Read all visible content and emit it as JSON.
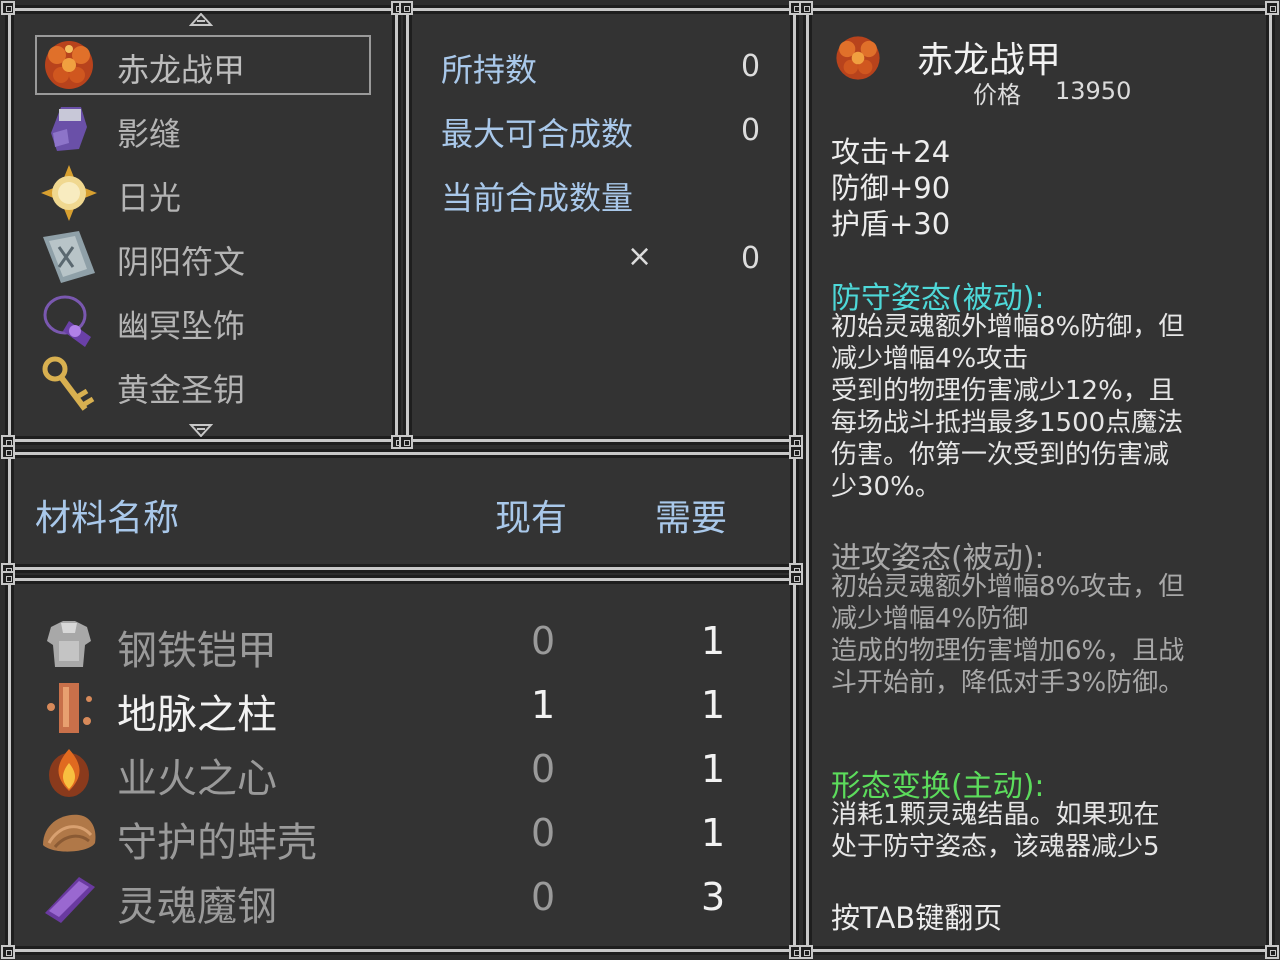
{
  "items": [
    {
      "label": "赤龙战甲",
      "icon": "red-dragon-armor-icon",
      "selected": true
    },
    {
      "label": "影缝",
      "icon": "purple-gauntlet-icon",
      "selected": false
    },
    {
      "label": "日光",
      "icon": "sun-gem-icon",
      "selected": false
    },
    {
      "label": "阴阳符文",
      "icon": "rune-tablet-icon",
      "selected": false
    },
    {
      "label": "幽冥坠饰",
      "icon": "purple-pendant-icon",
      "selected": false
    },
    {
      "label": "黄金圣钥",
      "icon": "golden-key-icon",
      "selected": false
    }
  ],
  "stats": {
    "owned_label": "所持数",
    "owned_value": "0",
    "max_label": "最大可合成数",
    "max_value": "0",
    "current_label": "当前合成数量",
    "multiply_symbol": "×",
    "current_value": "0"
  },
  "materials_header": {
    "name": "材料名称",
    "have": "现有",
    "need": "需要"
  },
  "materials": [
    {
      "name": "钢铁铠甲",
      "have": "0",
      "need": "1",
      "icon": "steel-armor-icon",
      "sufficient": false
    },
    {
      "name": "地脉之柱",
      "have": "1",
      "need": "1",
      "icon": "earth-pillar-icon",
      "sufficient": true
    },
    {
      "name": "业火之心",
      "have": "0",
      "need": "1",
      "icon": "hellfire-heart-icon",
      "sufficient": false
    },
    {
      "name": "守护的蚌壳",
      "have": "0",
      "need": "1",
      "icon": "clam-shell-icon",
      "sufficient": false
    },
    {
      "name": "灵魂魔钢",
      "have": "0",
      "need": "3",
      "icon": "soul-steel-ingot-icon",
      "sufficient": false
    }
  ],
  "detail": {
    "title": "赤龙战甲",
    "price_label": "价格",
    "price_value": "13950",
    "attack": "攻击+24",
    "defense": "防御+90",
    "shield": "护盾+30",
    "sec1_title": "防守姿态(被动):",
    "sec1_lines": [
      "初始灵魂额外增幅8%防御，但",
      "减少增幅4%攻击",
      "受到的物理伤害减少12%，且",
      "每场战斗抵挡最多1500点魔法",
      "伤害。你第一次受到的伤害减",
      "少30%。"
    ],
    "sec2_title": "进攻姿态(被动):",
    "sec2_lines": [
      "初始灵魂额外增幅8%攻击，但",
      "减少增幅4%防御",
      "造成的物理伤害增加6%，且战",
      "斗开始前，降低对手3%防御。"
    ],
    "sec3_title": "形态变换(主动):",
    "sec3_lines": [
      "消耗1颗灵魂结晶。如果现在",
      "处于防守姿态，该魂器减少5"
    ],
    "footer": "按TAB键翻页"
  },
  "colors": {
    "panel_bg": "#333333",
    "border": "#c8c8c8",
    "label_blue": "#a9c8ea",
    "cyan": "#4ed8d8",
    "green": "#5cdc5c",
    "dim": "#a8a8a8"
  }
}
